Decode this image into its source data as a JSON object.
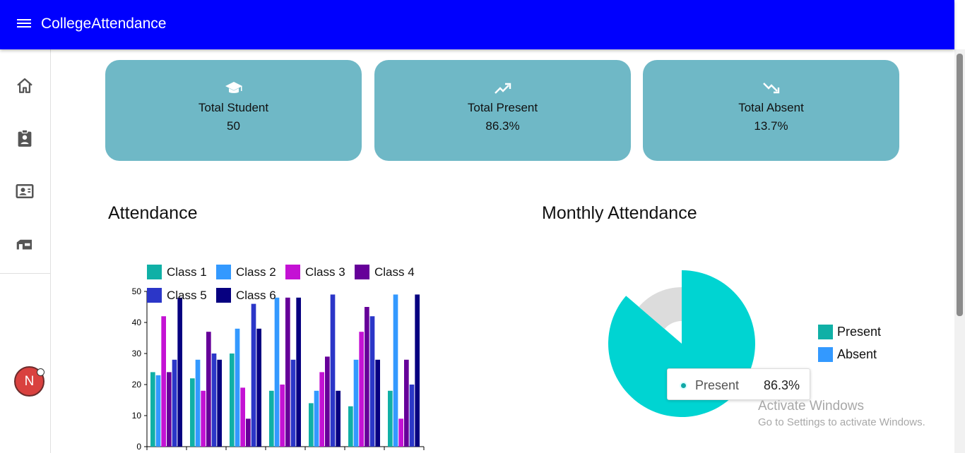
{
  "app": {
    "title": "CollegeAttendance"
  },
  "sidebar": {
    "items": [
      {
        "icon": "home-icon"
      },
      {
        "icon": "clipboard-account-icon"
      },
      {
        "icon": "contact-card-icon"
      },
      {
        "icon": "classroom-icon"
      }
    ],
    "avatar_initial": "N"
  },
  "cards": [
    {
      "icon": "graduation-cap-icon",
      "label": "Total Student",
      "value": "50"
    },
    {
      "icon": "trending-up-icon",
      "label": "Total Present",
      "value": "86.3%"
    },
    {
      "icon": "trending-down-icon",
      "label": "Total Absent",
      "value": "13.7%"
    }
  ],
  "sections": {
    "attendance_title": "Attendance",
    "monthly_title": "Monthly Attendance"
  },
  "colors": {
    "appbar": "#0000fe",
    "card": "#6fb8c6",
    "class1": "#10b0a6",
    "class2": "#3399ff",
    "class3": "#c412d4",
    "class4": "#660099",
    "class5": "#2b36c8",
    "class6": "#070080",
    "present": "#00d4d2",
    "absent": "#dcdcdc"
  },
  "chart_data": [
    {
      "type": "bar",
      "categories": [
        "",
        "",
        "",
        "",
        "",
        "",
        ""
      ],
      "series": [
        {
          "name": "Class 1",
          "color": "#10b0a6",
          "values": [
            24,
            22,
            30,
            18,
            14,
            13,
            18
          ]
        },
        {
          "name": "Class 2",
          "color": "#3399ff",
          "values": [
            23,
            28,
            38,
            48,
            18,
            28,
            49
          ]
        },
        {
          "name": "Class 3",
          "color": "#c412d4",
          "values": [
            42,
            18,
            19,
            20,
            24,
            37,
            9
          ]
        },
        {
          "name": "Class 4",
          "color": "#660099",
          "values": [
            24,
            37,
            9,
            48,
            29,
            45,
            28
          ]
        },
        {
          "name": "Class 5",
          "color": "#2b36c8",
          "values": [
            28,
            30,
            46,
            28,
            49,
            42,
            20
          ]
        },
        {
          "name": "Class 6",
          "color": "#070080",
          "values": [
            48,
            28,
            38,
            48,
            18,
            28,
            49
          ]
        }
      ],
      "yticks": [
        0,
        10,
        20,
        30,
        40,
        50
      ],
      "ylim": [
        0,
        50
      ],
      "legend": "top"
    },
    {
      "type": "pie",
      "slices": [
        {
          "name": "Present",
          "value": 86.3,
          "color": "#00d4d2",
          "legend_color": "#10b0a6"
        },
        {
          "name": "Absent",
          "value": 13.7,
          "color": "#dcdcdc",
          "legend_color": "#3399ff"
        }
      ],
      "legend": "right",
      "tooltip": {
        "label": "Present",
        "value": "86.3%"
      }
    }
  ],
  "watermark": {
    "line1": "Activate Windows",
    "line2": "Go to Settings to activate Windows."
  }
}
